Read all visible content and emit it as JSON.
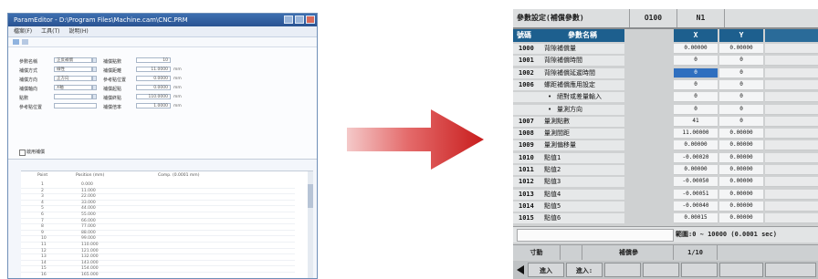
{
  "pc_window": {
    "title": "ParamEditor - D:\\Program Files\\Machine.cam\\CNC.PRM",
    "menu": [
      "檔案(F)",
      "工具(T)",
      "說明(H)"
    ],
    "form_left": [
      {
        "label": "參數名稱",
        "value": "正反補償"
      },
      {
        "label": "補償方式",
        "value": "線性"
      },
      {
        "label": "補償方向",
        "value": "正方向"
      },
      {
        "label": "補償軸向",
        "value": "X軸"
      },
      {
        "label": "點數",
        "value": ""
      },
      {
        "label": "參考點位置",
        "value": ""
      }
    ],
    "form_right": [
      {
        "label": "補償點數",
        "value": "10"
      },
      {
        "label": "補償距離",
        "value": "11.0000",
        "unit": "mm"
      },
      {
        "label": "參考點位置",
        "value": "0.0000",
        "unit": "mm"
      },
      {
        "label": "補償起點",
        "value": "0.0000",
        "unit": "mm"
      },
      {
        "label": "補償終點",
        "value": "110.0000",
        "unit": "mm"
      },
      {
        "label": "補償倍率",
        "value": "1.0000",
        "unit": "mm"
      }
    ],
    "checkbox_label": "啟用補償",
    "grid_headers": [
      "Point",
      "Position (mm)",
      "Comp. (0.0001 mm)"
    ],
    "grid_points": [
      "1",
      "2",
      "3",
      "4",
      "5",
      "6",
      "7",
      "8",
      "9",
      "10",
      "11",
      "12",
      "13",
      "14",
      "15",
      "16"
    ],
    "grid_positions": [
      "0.000",
      "11.000",
      "22.000",
      "33.000",
      "44.000",
      "55.000",
      "66.000",
      "77.000",
      "88.000",
      "99.000",
      "110.000",
      "121.000",
      "132.000",
      "143.000",
      "154.000",
      "165.000"
    ]
  },
  "cnc": {
    "header": {
      "title": "參數設定(補償參數)",
      "prog": "O100",
      "seq": "N1"
    },
    "columns": {
      "no": "號碼",
      "name": "參數名稱",
      "x": "X",
      "y": "Y"
    },
    "rows": [
      {
        "no": "1000",
        "name": "背隙補償量",
        "x": "0.00000",
        "y": "0.00000"
      },
      {
        "no": "1001",
        "name": "背隙補償時間",
        "x": "0",
        "y": "0"
      },
      {
        "no": "1002",
        "name": "背隙補償延遲時間",
        "x": "0",
        "y": "0"
      },
      {
        "no": "1006",
        "name": "螺距補償應用設定",
        "x": "0",
        "y": "0"
      },
      {
        "no": "",
        "name": "絕對或差量輸入",
        "x": "0",
        "y": "0"
      },
      {
        "no": "",
        "name": "量測方向",
        "x": "0",
        "y": "0"
      },
      {
        "no": "1007",
        "name": "量測點數",
        "x": "41",
        "y": "0"
      },
      {
        "no": "1008",
        "name": "量測間距",
        "x": "11.00000",
        "y": "0.00000"
      },
      {
        "no": "1009",
        "name": "量測偏移量",
        "x": "0.00000",
        "y": "0.00000"
      },
      {
        "no": "1010",
        "name": "點值1",
        "x": "-0.00020",
        "y": "0.00000"
      },
      {
        "no": "1011",
        "name": "點值2",
        "x": "0.00000",
        "y": "0.00000"
      },
      {
        "no": "1012",
        "name": "點值3",
        "x": "-0.00050",
        "y": "0.00000"
      },
      {
        "no": "1013",
        "name": "點值4",
        "x": "-0.00051",
        "y": "0.00000"
      },
      {
        "no": "1014",
        "name": "點值5",
        "x": "-0.00040",
        "y": "0.00000"
      },
      {
        "no": "1015",
        "name": "點值6",
        "x": "0.00015",
        "y": "0.00000"
      }
    ],
    "range_text": "範圍:0 ~ 10000 (0.0001 sec)",
    "status": {
      "mode": "寸動",
      "sub": "補償參",
      "page": "1/10"
    },
    "keys": [
      "進入",
      "進入:"
    ]
  }
}
